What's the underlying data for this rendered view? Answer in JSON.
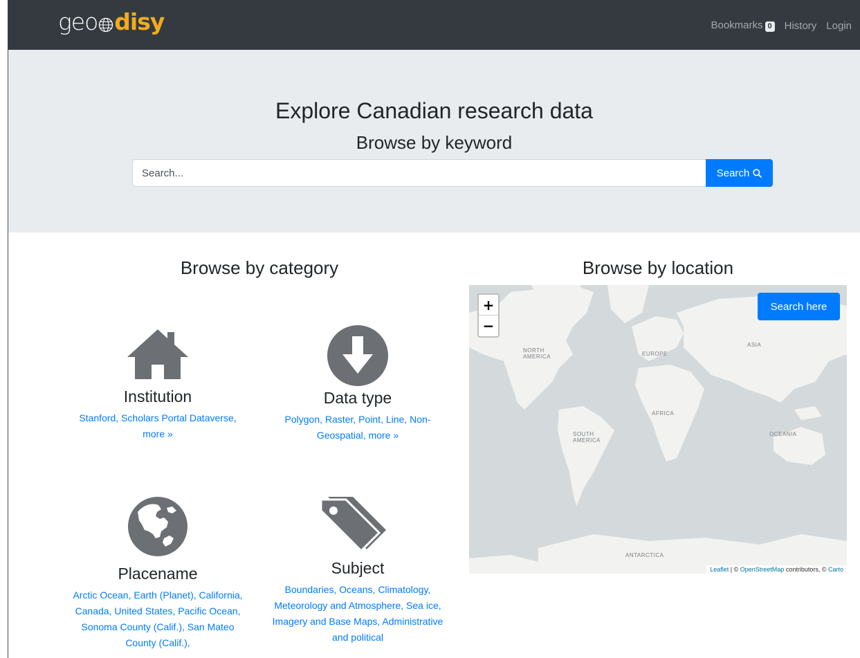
{
  "navbar": {
    "logo_left": "geo",
    "logo_right": "disy",
    "bookmarks_label": "Bookmarks",
    "bookmarks_count": "0",
    "history_label": "History",
    "login_label": "Login"
  },
  "hero": {
    "title": "Explore Canadian research data",
    "subtitle": "Browse by keyword",
    "search_placeholder": "Search...",
    "search_button": "Search"
  },
  "category": {
    "title": "Browse by category",
    "items": [
      {
        "name": "Institution",
        "icon": "home-icon",
        "links": [
          "Stanford",
          "Scholars Portal Dataverse"
        ],
        "more": "more »"
      },
      {
        "name": "Data type",
        "icon": "download-circle-icon",
        "links": [
          "Polygon",
          "Raster",
          "Point",
          "Line",
          "Non-Geospatial"
        ],
        "more": "more »"
      },
      {
        "name": "Placename",
        "icon": "globe-icon",
        "links": [
          "Arctic Ocean",
          "Earth (Planet)",
          "California",
          "Canada",
          "United States",
          "Pacific Ocean",
          "Sonoma County (Calif.)",
          "San Mateo County (Calif.)"
        ]
      },
      {
        "name": "Subject",
        "icon": "tags-icon",
        "links": [
          "Boundaries",
          "Oceans",
          "Climatology",
          "Meteorology and Atmosphere",
          "Sea ice",
          "Imagery and Base Maps",
          "Administrative and political"
        ]
      }
    ]
  },
  "location": {
    "title": "Browse by location",
    "zoom_in": "+",
    "zoom_out": "−",
    "search_here": "Search here",
    "labels": [
      "NORTH AMERICA",
      "EUROPE",
      "ASIA",
      "AFRICA",
      "SOUTH AMERICA",
      "OCEANIA",
      "ANTARCTICA"
    ],
    "attribution": {
      "leaflet": "Leaflet",
      "sep": " | © ",
      "osm": "OpenStreetMap",
      "contrib": " contributors, © ",
      "carto": "Carto"
    }
  },
  "colors": {
    "navbar": "#343a40",
    "accent": "#007bff",
    "logo_orange": "#f0ab1f",
    "hero_bg": "#e9ecef",
    "icon_gray": "#6c6f73"
  }
}
